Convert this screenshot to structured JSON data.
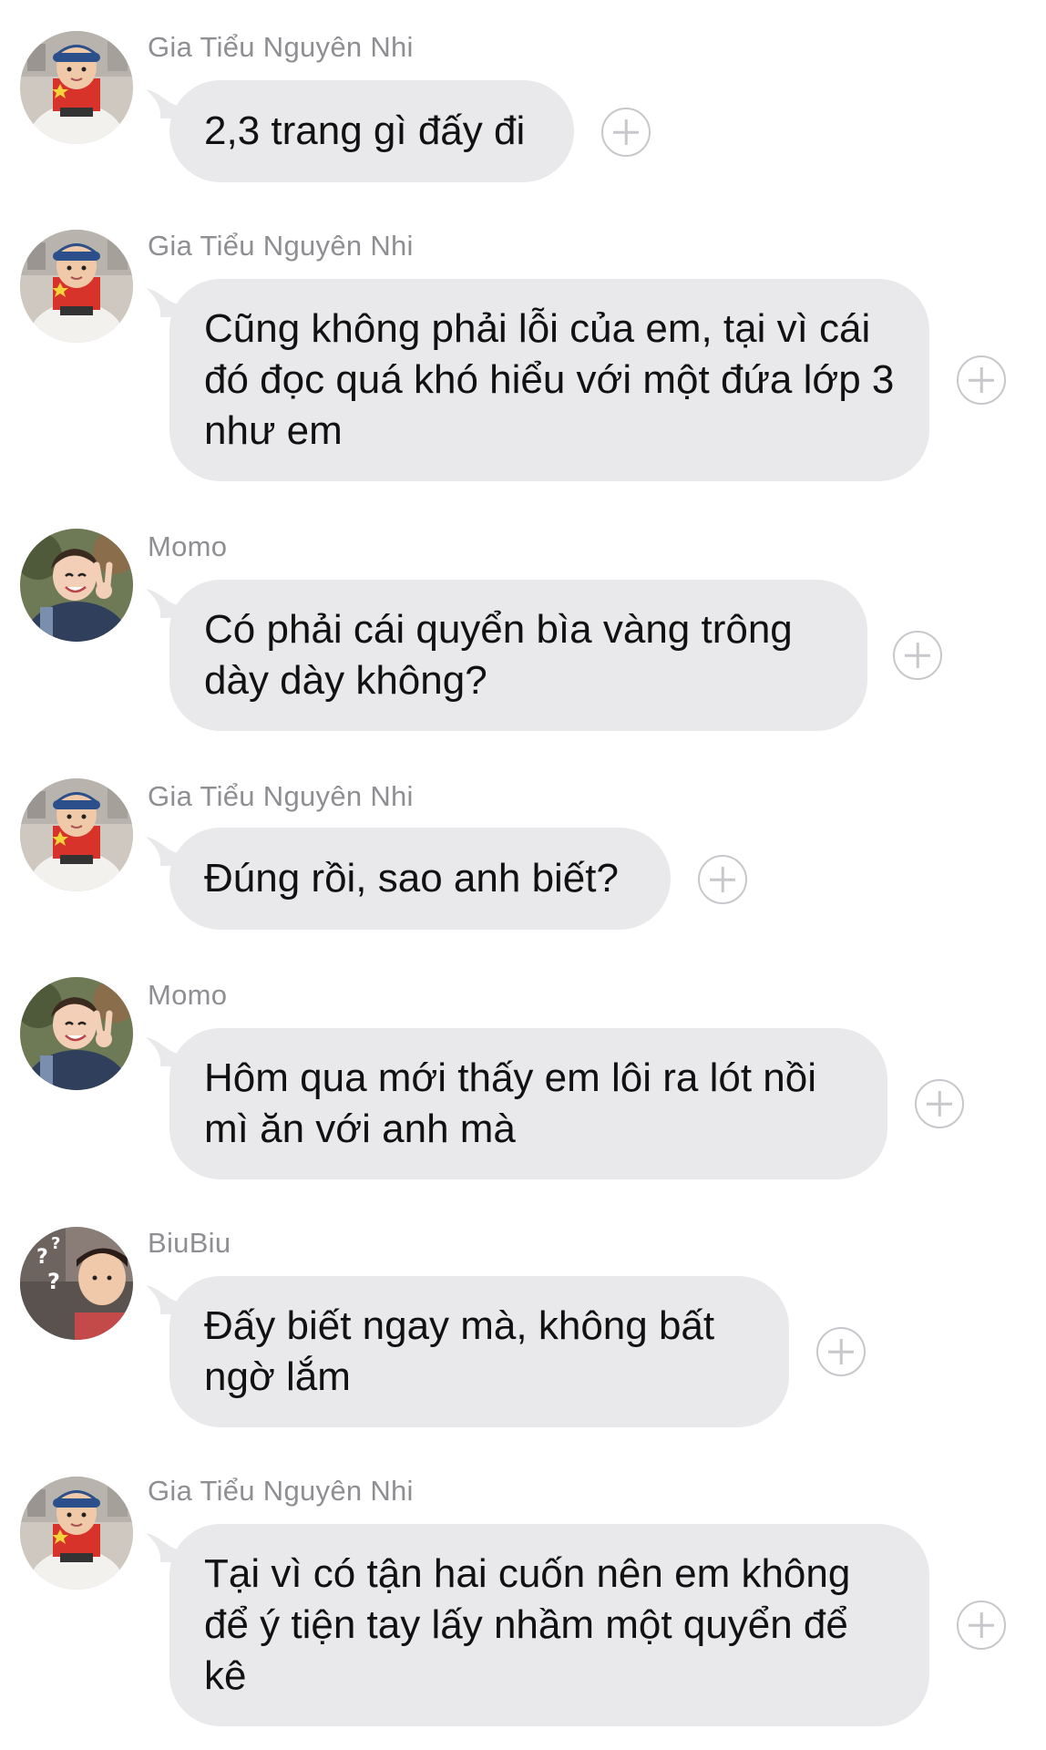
{
  "messages": [
    {
      "sender": "Gia Tiểu Nguyên Nhi",
      "avatar": "boy-cap-avatar",
      "text": "2,3 trang gì đấy đi"
    },
    {
      "sender": "Gia Tiểu Nguyên Nhi",
      "avatar": "boy-cap-avatar",
      "text": "Cũng không phải lỗi của em, tại vì cái đó đọc quá khó hiểu với một đứa lớp 3 như em"
    },
    {
      "sender": "Momo",
      "avatar": "boy-peace-sign-avatar",
      "text": "Có phải cái quyển bìa vàng trông dày dày không?"
    },
    {
      "sender": "Gia Tiểu Nguyên Nhi",
      "avatar": "boy-cap-avatar",
      "text": "Đúng rồi, sao anh biết?"
    },
    {
      "sender": "Momo",
      "avatar": "boy-peace-sign-avatar",
      "text": "Hôm qua mới thấy em lôi ra lót nồi mì ăn với anh mà"
    },
    {
      "sender": "BiuBiu",
      "avatar": "boy-question-marks-avatar",
      "text": "Đấy biết ngay mà, không bất ngờ lắm"
    },
    {
      "sender": "Gia Tiểu Nguyên Nhi",
      "avatar": "boy-cap-avatar",
      "text": "Tại vì có tận hai cuốn nên em không để ý tiện tay lấy nhầm một quyển để kê"
    }
  ],
  "colors": {
    "bubble": "#e9e9eb",
    "sender": "#8e8e93",
    "text": "#111111",
    "plus_icon": "#c7c7cc"
  }
}
